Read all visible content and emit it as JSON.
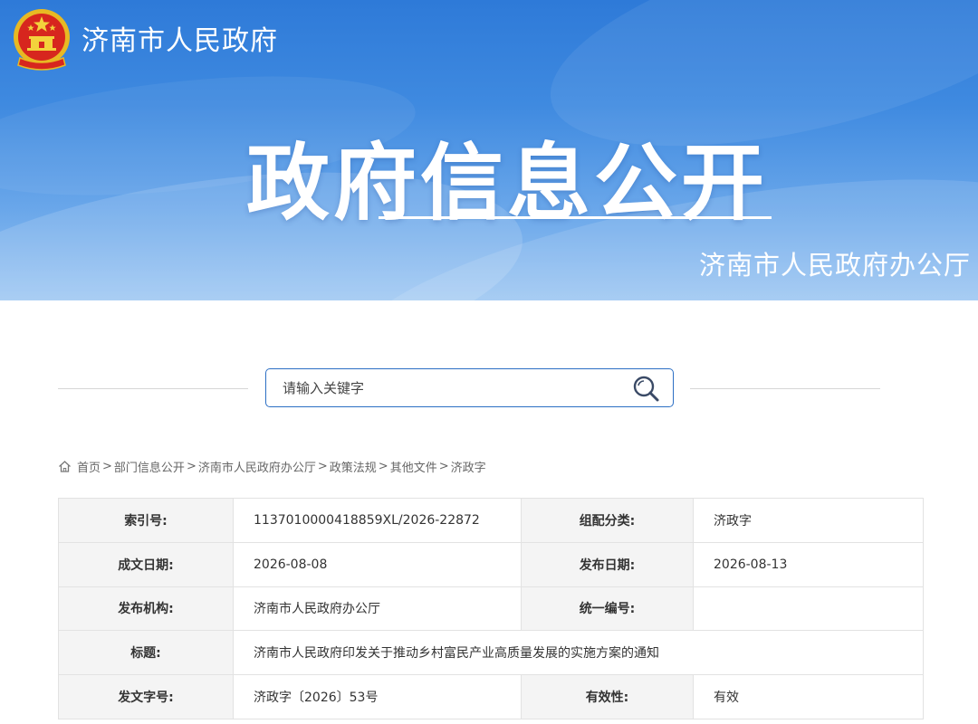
{
  "header": {
    "site_name": "济南市人民政府",
    "big_title": "政府信息公开",
    "office_name": "济南市人民政府办公厅",
    "emblem_icon": "national-emblem-icon"
  },
  "search": {
    "placeholder": "请输入关键字",
    "value": "",
    "button_icon": "search-icon",
    "accent_color": "#2c6fc4"
  },
  "breadcrumb": {
    "home_icon": "home-icon",
    "items": [
      "首页",
      "部门信息公开",
      "济南市人民政府办公厅",
      "政策法规",
      "其他文件",
      "济政字"
    ],
    "separator": ">"
  },
  "info": {
    "index_no_label": "索引号:",
    "index_no": "1137010000418859XL/2026-22872",
    "category_label": "组配分类:",
    "category": "济政字",
    "written_date_label": "成文日期:",
    "written_date": "2026-08-08",
    "publish_date_label": "发布日期:",
    "publish_date": "2026-08-13",
    "issuer_label": "发布机构:",
    "issuer": "济南市人民政府办公厅",
    "unified_no_label": "统一编号:",
    "unified_no": "",
    "title_label": "标题:",
    "title": "济南市人民政府印发关于推动乡村富民产业高质量发展的实施方案的通知",
    "doc_no_label": "发文字号:",
    "doc_no": "济政字〔2026〕53号",
    "validity_label": "有效性:",
    "validity": "有效"
  }
}
